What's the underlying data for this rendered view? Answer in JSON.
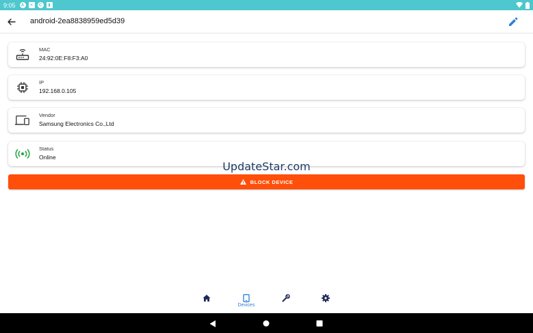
{
  "status_bar": {
    "time": "9:05",
    "notifications": [
      "A",
      "✕",
      "C",
      "▮"
    ],
    "icons": [
      "wifi-icon",
      "battery-icon"
    ]
  },
  "app_bar": {
    "title": "android-2ea8838959ed5d39",
    "back_icon": "arrow-back-icon",
    "edit_icon": "pencil-icon"
  },
  "cards": [
    {
      "label": "MAC",
      "value": "24:92:0E:F8:F3:A0",
      "icon": "router-icon"
    },
    {
      "label": "IP",
      "value": "192.168.0.105",
      "icon": "chip-icon"
    },
    {
      "label": "Vendor",
      "value": "Samsung Electronics Co.,Ltd",
      "icon": "devices-icon"
    },
    {
      "label": "Status",
      "value": "Online",
      "icon": "online-signal-icon"
    }
  ],
  "watermark": "UpdateStar.com",
  "block_button": {
    "label": "BLOCK DEVICE",
    "icon": "warning-icon"
  },
  "bottom_nav": {
    "items": [
      {
        "id": "home",
        "icon": "home-icon",
        "label": ""
      },
      {
        "id": "devices",
        "icon": "tablet-icon",
        "label": "Devices",
        "active": true
      },
      {
        "id": "tools",
        "icon": "wrench-icon",
        "label": ""
      },
      {
        "id": "settings",
        "icon": "gear-icon",
        "label": ""
      }
    ]
  },
  "colors": {
    "status_bar": "#4ec7cf",
    "accent": "#2d7fd3",
    "nav_icon": "#1e2a5a",
    "block_button": "#ff4f0a",
    "online": "#2aa84a"
  },
  "system_nav": [
    "back-triangle-icon",
    "home-circle-icon",
    "recents-square-icon"
  ]
}
